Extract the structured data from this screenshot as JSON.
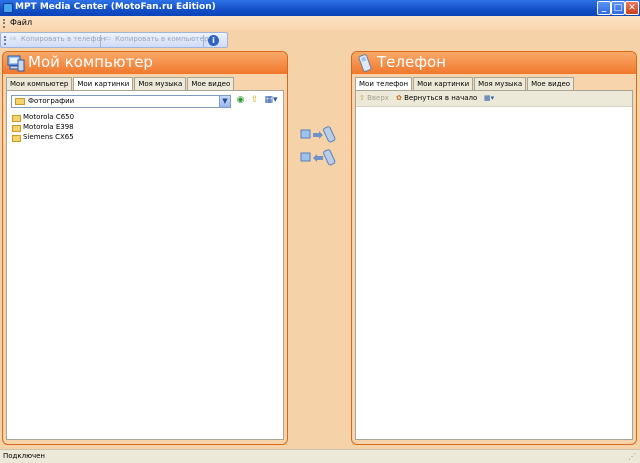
{
  "window": {
    "title": "MPT Media Center (MotoFan.ru Edition)"
  },
  "menu": {
    "file": "Файл"
  },
  "toolbar": {
    "copy_to_phone": "Копировать в телефон",
    "copy_to_computer": "Копировать в компьютер"
  },
  "left_panel": {
    "title": "Мой компьютер",
    "tabs": [
      "Мои компьютер",
      "Мои картинки",
      "Моя музыка",
      "Мое видео"
    ],
    "active_tab": 1,
    "path_value": "Фотографии",
    "items": [
      "Motorola C650",
      "Motorola E398",
      "Siemens CX65"
    ]
  },
  "right_panel": {
    "title": "Телефон",
    "tabs": [
      "Мои телефон",
      "Мои картинки",
      "Моя музыка",
      "Мое видео"
    ],
    "active_tab": 0,
    "up_label": "Вверх",
    "home_label": "Вернуться в начало"
  },
  "status": {
    "text": "Подключен"
  },
  "colors": {
    "accent_orange": "#f0782c",
    "title_blue": "#1652c9",
    "panel_bg": "#f7d4ac"
  }
}
